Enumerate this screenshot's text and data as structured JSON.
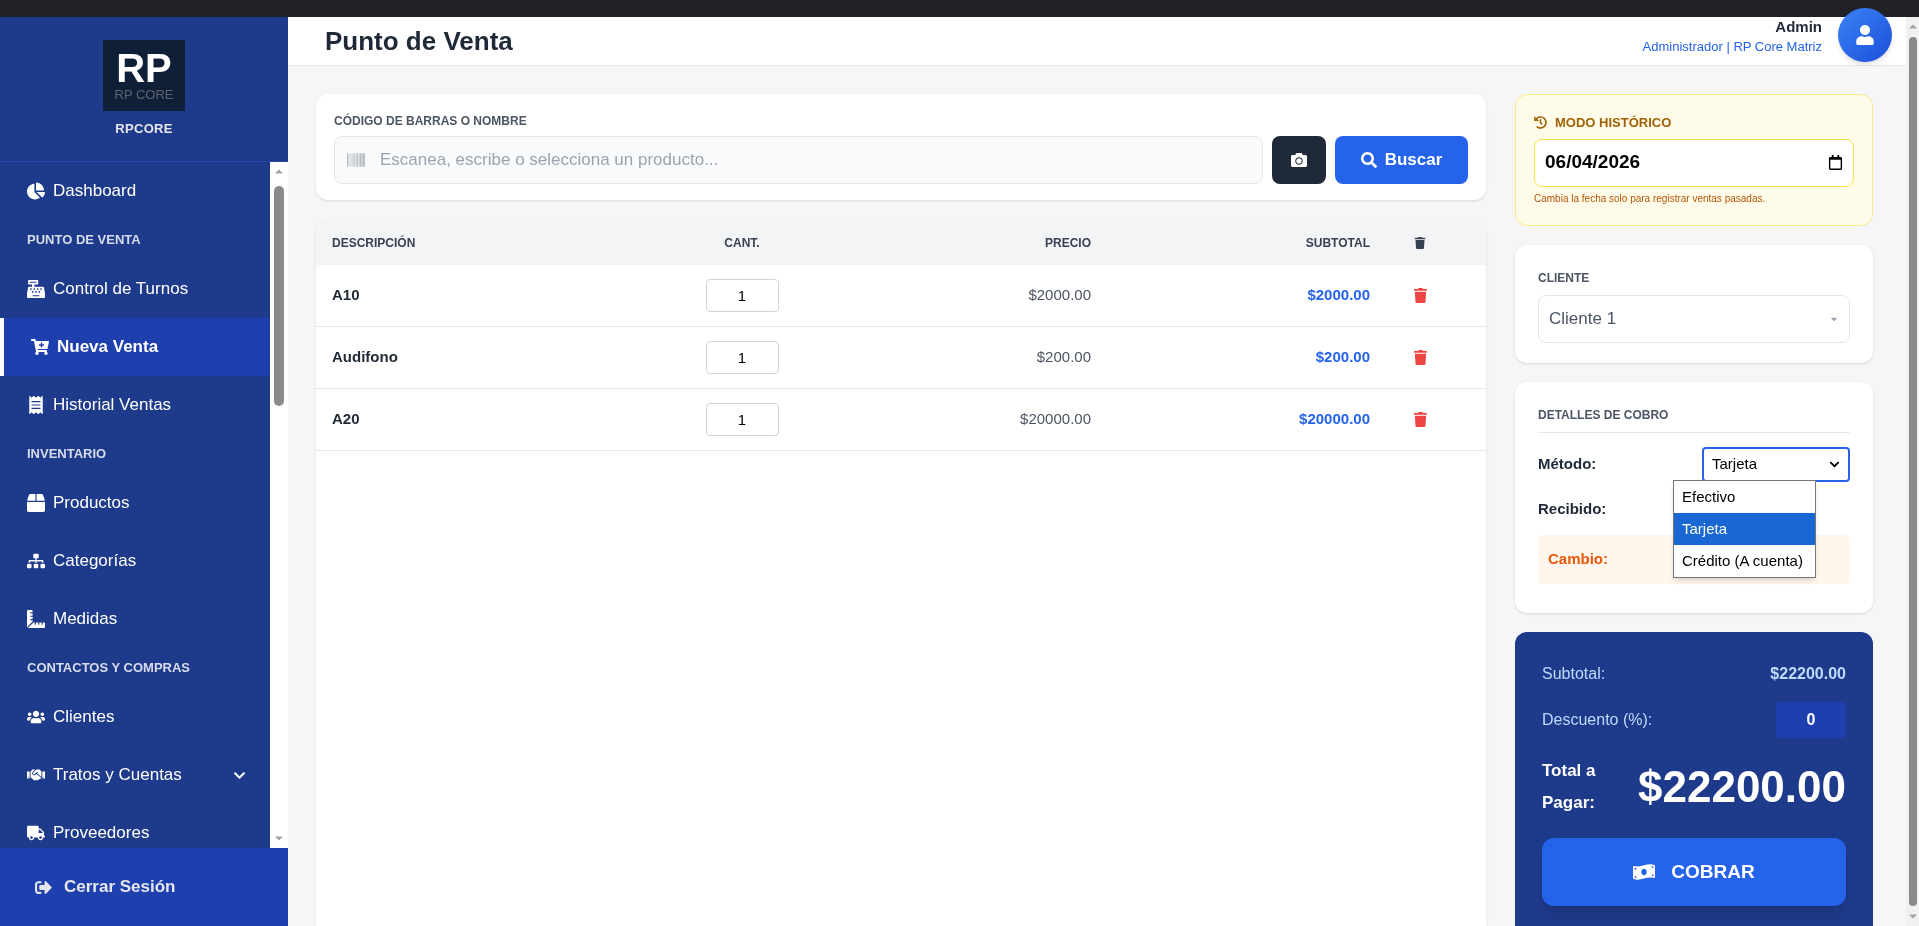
{
  "sidebar": {
    "logo": {
      "mark": "RP",
      "caption": "RP CORE"
    },
    "brand": "RPCORE",
    "items": [
      {
        "kind": "item",
        "label": "Dashboard",
        "selected": false
      },
      {
        "kind": "section",
        "label": "PUNTO DE VENTA"
      },
      {
        "kind": "item",
        "label": "Control de Turnos",
        "selected": false
      },
      {
        "kind": "item",
        "label": "Nueva Venta",
        "selected": true
      },
      {
        "kind": "item",
        "label": "Historial Ventas",
        "selected": false
      },
      {
        "kind": "section",
        "label": "INVENTARIO"
      },
      {
        "kind": "item",
        "label": "Productos",
        "selected": false
      },
      {
        "kind": "item",
        "label": "Categorías",
        "selected": false
      },
      {
        "kind": "item",
        "label": "Medidas",
        "selected": false
      },
      {
        "kind": "section",
        "label": "CONTACTOS Y COMPRAS"
      },
      {
        "kind": "item",
        "label": "Clientes",
        "selected": false
      },
      {
        "kind": "item",
        "label": "Tratos y Cuentas",
        "selected": false,
        "expandable": true
      },
      {
        "kind": "item",
        "label": "Proveedores",
        "selected": false
      }
    ],
    "logout": "Cerrar Sesión"
  },
  "header": {
    "title": "Punto de Venta",
    "user": "Admin",
    "role": "Administrador | RP Core Matriz"
  },
  "search": {
    "label": "CÓDIGO DE BARRAS O NOMBRE",
    "placeholder": "Escanea, escribe o selecciona un producto...",
    "button": "Buscar"
  },
  "table": {
    "columns": [
      "DESCRIPCIÓN",
      "CANT.",
      "PRECIO",
      "SUBTOTAL"
    ],
    "rows": [
      {
        "description": "A10",
        "qty": "1",
        "price": "$2000.00",
        "subtotal": "$2000.00"
      },
      {
        "description": "Audifono",
        "qty": "1",
        "price": "$200.00",
        "subtotal": "$200.00"
      },
      {
        "description": "A20",
        "qty": "1",
        "price": "$20000.00",
        "subtotal": "$20000.00"
      }
    ]
  },
  "historic": {
    "title": "MODO HISTÓRICO",
    "date": "06/04/2026",
    "hint": "Cambia la fecha solo para registrar ventas pasadas."
  },
  "client": {
    "label": "CLIENTE",
    "value": "Cliente 1"
  },
  "payment": {
    "title": "DETALLES DE COBRO",
    "method_label": "Método:",
    "method_value": "Tarjeta",
    "options": [
      {
        "label": "Efectivo",
        "selected": false
      },
      {
        "label": "Tarjeta",
        "selected": true
      },
      {
        "label": "Crédito (A cuenta)",
        "selected": false
      }
    ],
    "received_label": "Recibido:",
    "change_label": "Cambio:"
  },
  "totals": {
    "subtotal_label": "Subtotal:",
    "subtotal": "$22200.00",
    "discount_label": "Descuento (%):",
    "discount": "0",
    "total_label": "Total a Pagar:",
    "total": "$22200.00",
    "button": "COBRAR"
  }
}
